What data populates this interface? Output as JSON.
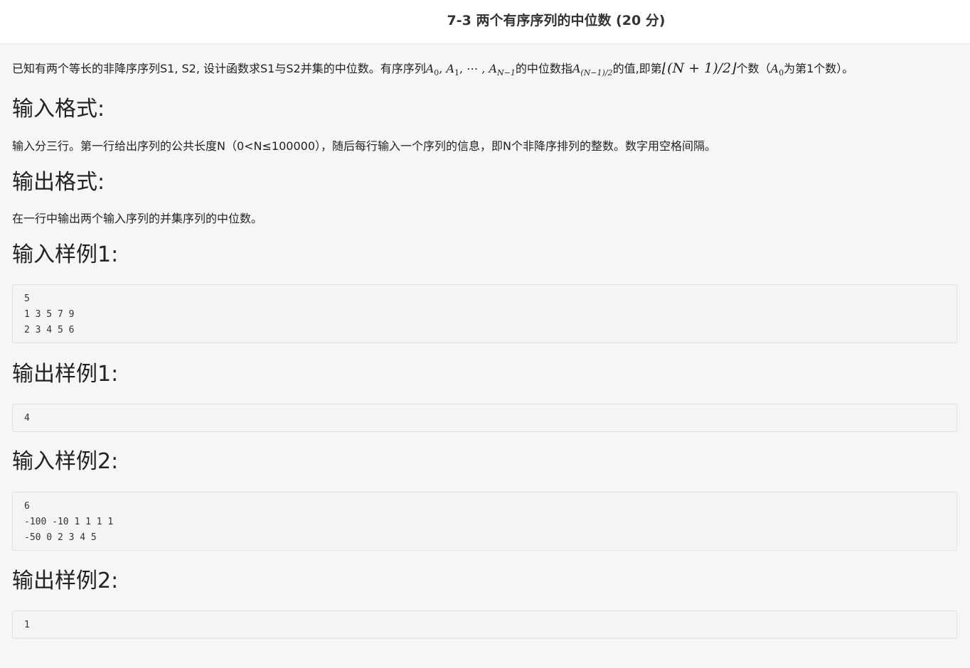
{
  "header": {
    "title": "7-3 两个有序序列的中位数 (20 分)"
  },
  "intro": {
    "part1": "已知有两个等长的非降序序列S1, S2, 设计函数求S1与S2并集的中位数。有序序列",
    "seq": "A",
    "sub0": "0",
    "comma1": ", ",
    "sub1": "1",
    "dots": ", ⋯ , ",
    "subN": "N−1",
    "part2": "的中位数指",
    "subMid": "(N−1)/2",
    "part3": "的值,即第",
    "floor_expr": "⌊(N + 1)/2⌋",
    "part4": "个数（",
    "sub_a0": "0",
    "part5": "为第1个数）。"
  },
  "sections": {
    "input_format_heading": "输入格式:",
    "input_format_text": "输入分三行。第一行给出序列的公共长度N（0<N≤100000），随后每行输入一个序列的信息，即N个非降序排列的整数。数字用空格间隔。",
    "output_format_heading": "输出格式:",
    "output_format_text": "在一行中输出两个输入序列的并集序列的中位数。",
    "sample_in_1_heading": "输入样例1:",
    "sample_in_1": "5\n1 3 5 7 9\n2 3 4 5 6",
    "sample_out_1_heading": "输出样例1:",
    "sample_out_1": "4",
    "sample_in_2_heading": "输入样例2:",
    "sample_in_2": "6\n-100 -10 1 1 1 1\n-50 0 2 3 4 5",
    "sample_out_2_heading": "输出样例2:",
    "sample_out_2": "1"
  }
}
